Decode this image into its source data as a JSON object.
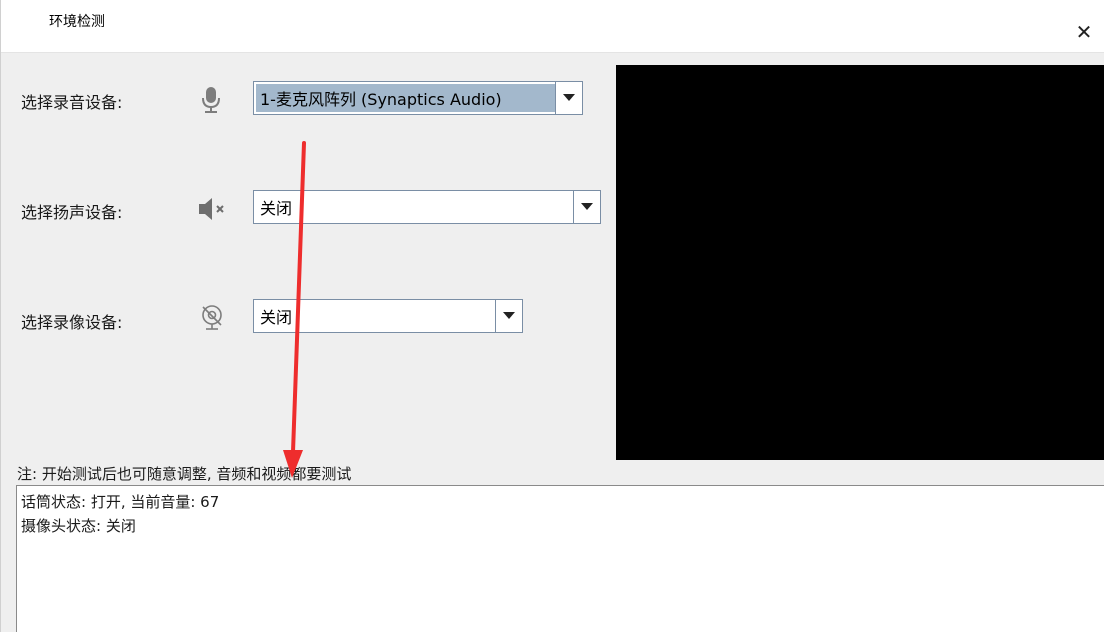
{
  "window": {
    "title": "环境检测",
    "close_glyph": "✕"
  },
  "rows": [
    {
      "label": "选择录音设备:",
      "icon": "microphone-icon",
      "value": "1-麦克风阵列 (Synaptics Audio)",
      "selected": true
    },
    {
      "label": "选择扬声设备:",
      "icon": "speaker-muted-icon",
      "value": "关闭",
      "selected": false
    },
    {
      "label": "选择录像设备:",
      "icon": "camera-off-icon",
      "value": "关闭",
      "selected": false
    }
  ],
  "note": "注: 开始测试后也可随意调整, 音频和视频都要测试",
  "log": {
    "lines": [
      "话筒状态: 打开, 当前音量: 67",
      "摄像头状态: 关闭"
    ]
  },
  "colors": {
    "window_bg": "#efefef",
    "preview_bg": "#000000",
    "selection_bg": "#a3b8cc",
    "annotation_arrow": "#ee2d2d"
  }
}
